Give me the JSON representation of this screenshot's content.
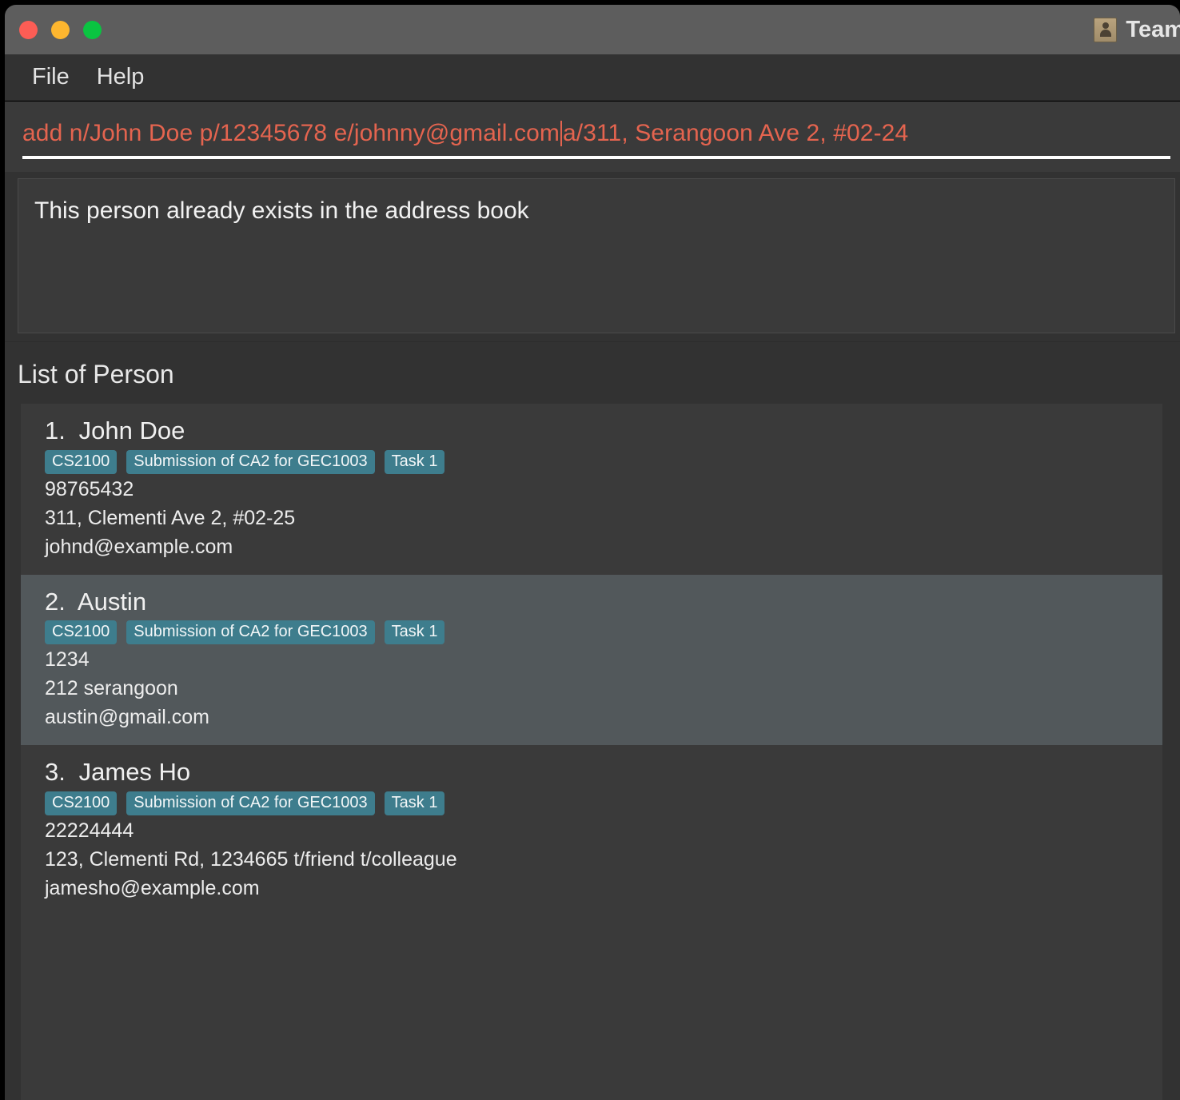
{
  "window": {
    "title": "Team",
    "icon": "address-book-icon",
    "traffic_lights": {
      "close_color": "#fc5d55",
      "minimize_color": "#fdb62f",
      "maximize_color": "#0ac441"
    }
  },
  "menubar": {
    "items": [
      {
        "label": "File"
      },
      {
        "label": "Help"
      }
    ]
  },
  "command_box": {
    "value_before_caret": "add n/John Doe p/12345678 e/johnny@gmail.com",
    "value_after_caret": "a/311, Serangoon Ave 2, #02-24",
    "text_color": "#e4644f"
  },
  "result_display": {
    "message": "This person already exists in the address book"
  },
  "person_list": {
    "title": "List of Person",
    "persons": [
      {
        "index": "1.",
        "name": "John Doe",
        "tags": [
          "CS2100",
          "Submission of CA2 for GEC1003",
          "Task 1"
        ],
        "phone": "98765432",
        "address": "311, Clementi Ave 2, #02-25",
        "email": "johnd@example.com",
        "selected": false
      },
      {
        "index": "2.",
        "name": "Austin",
        "tags": [
          "CS2100",
          "Submission of CA2 for GEC1003",
          "Task 1"
        ],
        "phone": "1234",
        "address": "212 serangoon",
        "email": "austin@gmail.com",
        "selected": true
      },
      {
        "index": "3.",
        "name": "James Ho",
        "tags": [
          "CS2100",
          "Submission of CA2 for GEC1003",
          "Task 1"
        ],
        "phone": "22224444",
        "address": "123, Clementi Rd, 1234665 t/friend t/colleague",
        "email": "jamesho@example.com",
        "selected": false
      }
    ],
    "tag_color": "#3e7d8d",
    "selected_row_color": "#52585b"
  }
}
